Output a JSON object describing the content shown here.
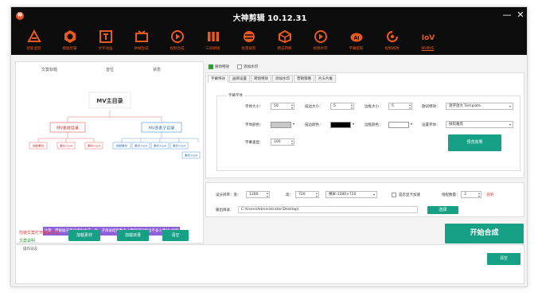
{
  "app": {
    "title": "大神剪辑 10.12.31",
    "logo_text": "神",
    "min_glyph": "—",
    "close_glyph": "✕"
  },
  "toolbar": [
    {
      "icon": "triangle-a-icon",
      "label": "智能混剪"
    },
    {
      "icon": "hexagon-record-icon",
      "label": "模板剪辑"
    },
    {
      "icon": "text-frame-icon",
      "label": "文字动画"
    },
    {
      "icon": "merge-icon",
      "label": "拼帧合成"
    },
    {
      "icon": "play-circle-icon",
      "label": "视频合成"
    },
    {
      "icon": "bars-icon",
      "label": "三屏拼接"
    },
    {
      "icon": "batch-icon",
      "label": "批量裁剪"
    },
    {
      "icon": "box-icon",
      "label": "精支转换"
    },
    {
      "icon": "play-download-icon",
      "label": "视频水印"
    },
    {
      "icon": "ai-badge-icon",
      "label": "字幕提取"
    },
    {
      "icon": "swirl-icon",
      "label": "视频格改"
    },
    {
      "icon": "mv-logo-icon",
      "label": "MV制作"
    }
  ],
  "left": {
    "col_headers": [
      "文案标题",
      "音位",
      "状态"
    ],
    "diagram": {
      "root": "MV主目录",
      "left_child": "MV素材目录",
      "right_child": "MV多素子目录",
      "left_leaves": [
        "视频素材",
        "素材.mp4",
        "素材.mp4"
      ],
      "right_leaves": [
        "视频素材",
        "素材.mp4",
        "素材.mp4",
        "素材.mp4",
        "素材.mp4"
      ]
    },
    "note": "注意：需根据子目录结构合成一样，子目录结果数多少需保持同步出不多少素MV视频",
    "red_note": "勿使文案打开编辑文案",
    "green_note": "文案说明",
    "btn_add_folder": "加载素材",
    "btn_load_dir": "加载目录",
    "btn_clear": "清空"
  },
  "right": {
    "top_checks": [
      {
        "label": "随场特效",
        "checked": true
      },
      {
        "label": "添加水印",
        "checked": false
      }
    ],
    "subtabs": [
      "字幕特效",
      "画目设置",
      "转场特效",
      "添加水印",
      "营销策略",
      "片头片尾"
    ],
    "font_group": "字幕字体",
    "labels": {
      "font_size": "字体大小：",
      "stroke_size": "描边大小：",
      "border_size": "边框大小：",
      "effect": "歌词特效：",
      "font_color": "字体颜色：",
      "stroke_color": "描边颜色：",
      "border_color": "边框颜色：",
      "font_face": "设置字体：",
      "font_vertical": "字幕垂直："
    },
    "values": {
      "font_size": "50",
      "stroke_size": "5",
      "border_size": "5",
      "effect": "逐字放大 Template",
      "font_face": "微软雅黑",
      "font_vertical": "100"
    },
    "colors": {
      "font": "#c8c8c8",
      "stroke": "#000000",
      "border": "#ffffff"
    },
    "preview_btn": "预览效果",
    "output": {
      "resolution_label": "设分辨率：宽：",
      "width": "1280",
      "height_label": "高：",
      "height": "720",
      "preset": "横屏-1280×720",
      "gpu_label": "是否显卡加速",
      "threads_label": "线程数量：",
      "threads": "3",
      "threads_hint": "说明",
      "dir_label": "输出目录：",
      "dir_value": "C:\\Users\\Administrator\\Desktop\\",
      "select_btn": "选择"
    },
    "start_btn": "开始合成"
  },
  "log": {
    "title": "操作日志",
    "clear_btn": "清空"
  },
  "accent": "#16a085"
}
